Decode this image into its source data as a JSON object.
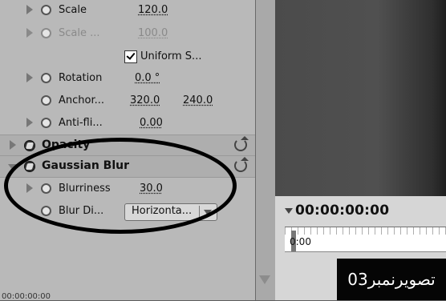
{
  "effect_controls": {
    "rows": {
      "scale": {
        "label": "Scale",
        "value": "120.0"
      },
      "scale_width": {
        "label": "Scale ...",
        "value": "100.0"
      },
      "uniform_scale": {
        "label": "Uniform S..."
      },
      "rotation": {
        "label": "Rotation",
        "value": "0.0 °"
      },
      "anchor": {
        "label": "Anchor...",
        "x": "320.0",
        "y": "240.0"
      },
      "anti_flicker": {
        "label": "Anti-fli...",
        "value": "0.00"
      }
    },
    "opacity": {
      "title": "Opacity"
    },
    "gaussian_blur": {
      "title": "Gaussian Blur",
      "blurriness": {
        "label": "Blurriness",
        "value": "30.0"
      },
      "blur_dimensions": {
        "label": "Blur Di...",
        "selected": "Horizonta..."
      }
    },
    "footer_time": "00:00:00:00"
  },
  "timeline": {
    "current_time": "00:00:00:00",
    "ruler_label": "0:00"
  },
  "watermark": {
    "text": "تصویرنمبر03"
  },
  "colors": {
    "panel_bg": "#b9b9b9",
    "annotation": "#000000",
    "watermark_bg": "#050505"
  }
}
